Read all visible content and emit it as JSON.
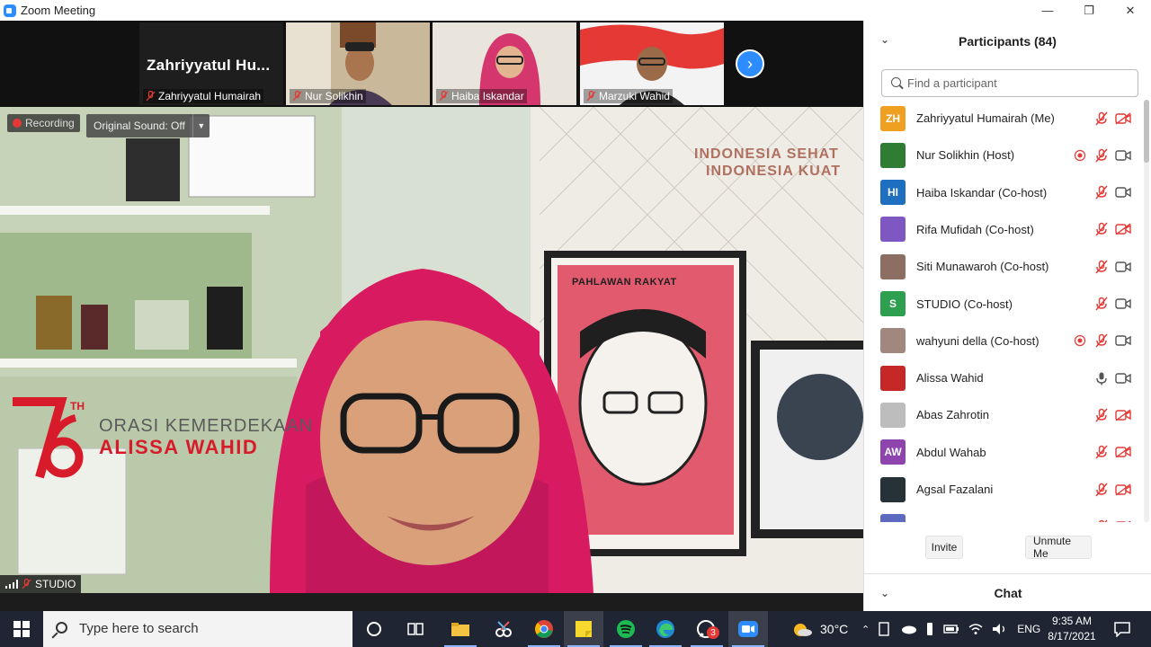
{
  "window": {
    "title": "Zoom Meeting",
    "minimize": "—",
    "restore": "❐",
    "close": "✕"
  },
  "strip": {
    "active_speaker_label": "Zahriyyatul  Hu...",
    "tiles": [
      {
        "name": "Zahriyyatul Humairah"
      },
      {
        "name": "Nur Solikhin"
      },
      {
        "name": "Haiba Iskandar"
      },
      {
        "name": "Marzuki Wahid"
      }
    ],
    "next_icon": "›"
  },
  "main": {
    "recording_label": "Recording",
    "original_sound": "Original Sound: Off",
    "speaker_name": "STUDIO",
    "overlay": {
      "line1": "INDONESIA SEHAT",
      "line2": "INDONESIA KUAT",
      "logo_sup": "TH",
      "orasi": "ORASI KEMERDEKAAN",
      "speaker": "ALISSA WAHID",
      "poster": "PAHLAWAN RAKYAT"
    }
  },
  "panel": {
    "title": "Participants (84)",
    "search_placeholder": "Find a participant",
    "participants": [
      {
        "initials": "ZH",
        "name": "Zahriyyatul Humairah (Me)",
        "color": "#f0a020",
        "rec": false,
        "mic": "muted",
        "video": "off"
      },
      {
        "initials": "",
        "name": "Nur Solikhin (Host)",
        "color": "#2e7d32",
        "rec": true,
        "mic": "muted",
        "video": "on"
      },
      {
        "initials": "HI",
        "name": "Haiba Iskandar (Co-host)",
        "color": "#1e6fbf",
        "rec": false,
        "mic": "muted",
        "video": "on"
      },
      {
        "initials": "",
        "name": "Rifa Mufidah (Co-host)",
        "color": "#7e57c2",
        "rec": false,
        "mic": "muted",
        "video": "off"
      },
      {
        "initials": "",
        "name": "Siti Munawaroh (Co-host)",
        "color": "#8d6e63",
        "rec": false,
        "mic": "muted",
        "video": "on"
      },
      {
        "initials": "S",
        "name": "STUDIO (Co-host)",
        "color": "#2e9e4f",
        "rec": false,
        "mic": "muted",
        "video": "on"
      },
      {
        "initials": "",
        "name": "wahyuni della (Co-host)",
        "color": "#a1887f",
        "rec": true,
        "mic": "muted",
        "video": "on"
      },
      {
        "initials": "",
        "name": "Alissa Wahid",
        "color": "#c62828",
        "rec": false,
        "mic": "on",
        "video": "on"
      },
      {
        "initials": "",
        "name": "Abas Zahrotin",
        "color": "#bdbdbd",
        "rec": false,
        "mic": "muted",
        "video": "off"
      },
      {
        "initials": "AW",
        "name": "Abdul Wahab",
        "color": "#8e44ad",
        "rec": false,
        "mic": "muted",
        "video": "off"
      },
      {
        "initials": "",
        "name": "Agsal Fazalani",
        "color": "#263238",
        "rec": false,
        "mic": "muted",
        "video": "off"
      },
      {
        "initials": "",
        "name": "",
        "color": "#5c6bc0",
        "rec": false,
        "mic": "muted",
        "video": "off"
      }
    ],
    "invite_label": "Invite",
    "unmute_label": "Unmute Me",
    "chat_label": "Chat"
  },
  "taskbar": {
    "search_placeholder": "Type here to search",
    "whatsapp_badge": "3",
    "temperature": "30°C",
    "language": "ENG",
    "time": "9:35 AM",
    "date": "8/17/2021"
  },
  "colors": {
    "accent": "#2d8cff",
    "muted_red": "#e53935",
    "taskbar": "#1f2533"
  }
}
